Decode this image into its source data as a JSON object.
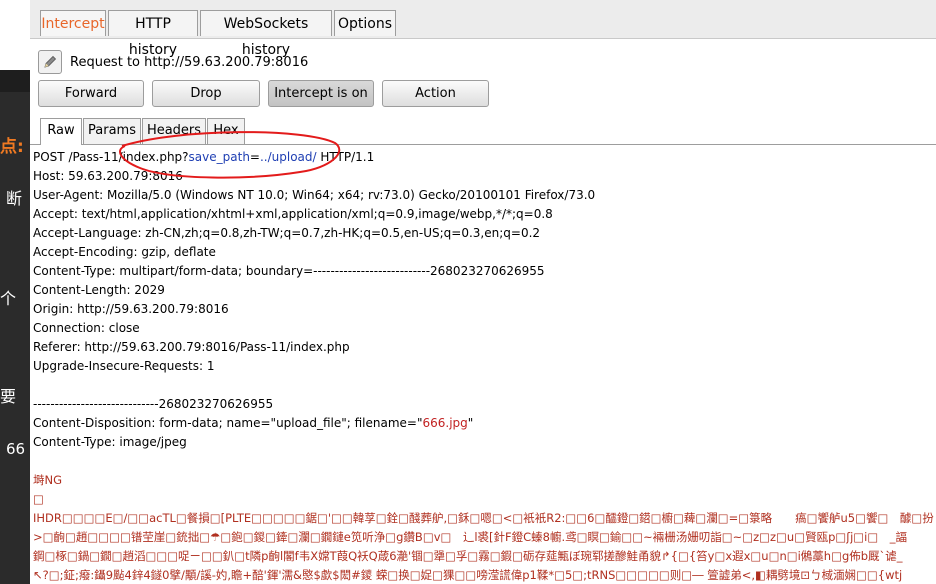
{
  "side": {
    "texts": [
      "点:",
      "断",
      "个",
      "要",
      "66"
    ]
  },
  "tabs": [
    {
      "label": "Intercept",
      "active": true
    },
    {
      "label": "HTTP history",
      "active": false
    },
    {
      "label": "WebSockets history",
      "active": false
    },
    {
      "label": "Options",
      "active": false
    }
  ],
  "request_target": "Request to http://59.63.200.79:8016",
  "buttons": {
    "forward": "Forward",
    "drop": "Drop",
    "intercept": "Intercept is on",
    "action": "Action"
  },
  "subtabs": [
    "Raw",
    "Params",
    "Headers",
    "Hex"
  ],
  "request": {
    "line1_pre": "POST /Pass-11/index.php?",
    "line1_param": "save_path",
    "line1_eq": "=",
    "line1_value": "../upload/",
    "line1_post": " HTTP/1.1",
    "headers": [
      "Host: 59.63.200.79:8016",
      "User-Agent: Mozilla/5.0 (Windows NT 10.0; Win64; x64; rv:73.0) Gecko/20100101 Firefox/73.0",
      "Accept: text/html,application/xhtml+xml,application/xml;q=0.9,image/webp,*/*;q=0.8",
      "Accept-Language: zh-CN,zh;q=0.8,zh-TW;q=0.7,zh-HK;q=0.5,en-US;q=0.3,en;q=0.2",
      "Accept-Encoding: gzip, deflate",
      "Content-Type: multipart/form-data; boundary=---------------------------268023270626955",
      "Content-Length: 2029",
      "Origin: http://59.63.200.79:8016",
      "Connection: close",
      "Referer: http://59.63.200.79:8016/Pass-11/index.php",
      "Upgrade-Insecure-Requests: 1"
    ],
    "boundary": "-----------------------------268023270626955",
    "disposition_pre": "Content-Disposition: form-data; name=\"upload_file\"; filename=\"",
    "filename": "666.jpg",
    "disposition_post": "\"",
    "part_content_type": "Content-Type: image/jpeg",
    "binary": [
      "塒NG",
      "",
      "IHDR□□□□E□/□□acTL□餐損□[PLTE□□□□□鋸□'□□韓莩□銓□醆葬舮,□鉌□嗯□<□衹衹R2:□□6□醽鐙□鍣□櫥□薭□瀾□=□箓略　　瘑□饗舻u5□饗□　醵□扮",
      ">□齣□趙□□□□镨茔崖□銃拙□☂□鉋□鍐□鏲□瀾□鐗鏈e笕听浄□g鑽B□v□　辶l裘[針F鐙C螓8幮.鸢□瞑□鍮□□~裲栅汤姗叨詣□~□z□z□u□賢瓯p□ʃj□i□　_諨",
      "鋼□椓□鍋□鐗□趙滔□□□哫ㄧ□□釟□t隣p齣l閣f韦X嫦T葭Q袄Q葴6濪'锢□犟□孚□霧□鍜□砺存莚甒ぼ琬郓搓醦鮭甬貌↱{□{笞y□x遐x□u□n□i鵂藁h□g佈b厩`谑_",
      "↖?□;鉦;癈:鑷9颭4鋅4鐩0擘/顒/謑-妁,瞻+醅'鍕'濡&愍$歔$閎#鑁 蝾□换□娖□猓□□嗙滢謊偉p1鞣*□5□;tRNS□□□□□则□― 箮譃弟<,◧耦劈境⊡ㄅ棫湎娴□□{wtj"
    ]
  }
}
